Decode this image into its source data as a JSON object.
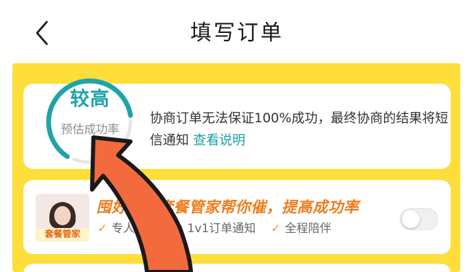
{
  "header": {
    "title": "填写订单",
    "back_icon": "chevron-left-icon"
  },
  "probability_card": {
    "level": "较高",
    "caption": "预估成功率",
    "description": "协商订单无法保证100%成功，最终协商的结果将短信通知",
    "link_label": "查看说明",
    "accent_color": "#20A3A8"
  },
  "service_card": {
    "avatar_badge": "套餐管家",
    "title": "囤好货，套餐管家帮你催，提高成功率",
    "features": [
      {
        "icon": "check-icon",
        "label": "专人催单"
      },
      {
        "icon": "check-icon",
        "label": "1v1订单通知"
      },
      {
        "icon": "check-icon",
        "label": "全程陪伴"
      }
    ],
    "toggle_on": false,
    "accent_color": "#EE7D1E"
  },
  "overlay": {
    "icon": "arrow-annotation",
    "color": "#F26A3D"
  },
  "colors": {
    "background_yellow": "#FEDE3A"
  }
}
